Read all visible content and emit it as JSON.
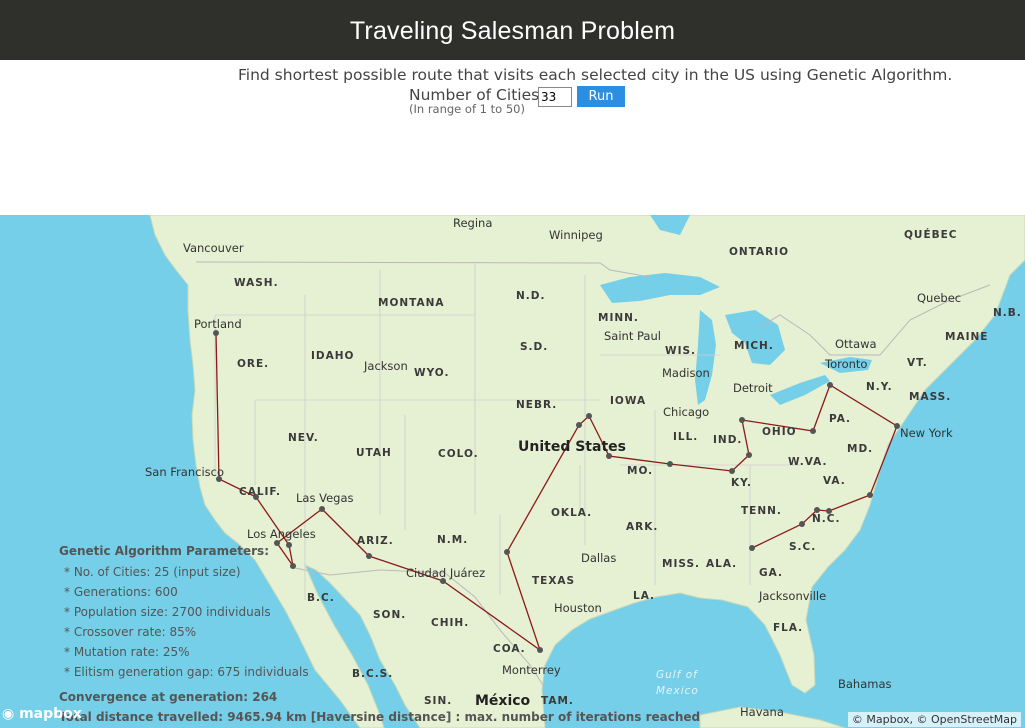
{
  "header": {
    "title": "Traveling Salesman Problem"
  },
  "subtitle": "Find shortest possible route that visits each selected city in the US using Genetic Algorithm.",
  "controls": {
    "cities_label": "Number of Cities",
    "cities_value": "33",
    "run_label": "Run",
    "range_hint": "(In range of 1 to 50)"
  },
  "map": {
    "colors": {
      "water": "#75cfe8",
      "land": "#e6f0d2",
      "route": "#8b1a1a",
      "node": "#555555"
    },
    "labels": {
      "regina": "Regina",
      "winnipeg": "Winnipeg",
      "vancouver": "Vancouver",
      "ontario": "ONTARIO",
      "quebec_prov": "QUÉBEC",
      "quebec_city": "Quebec",
      "wash": "WASH.",
      "montana": "MONTANA",
      "nd": "N.D.",
      "minn": "MINN.",
      "saint_paul": "Saint Paul",
      "wis": "WIS.",
      "mich": "MICH.",
      "ottawa": "Ottawa",
      "nb": "N.B.",
      "maine": "MAINE",
      "portland": "Portland",
      "idaho": "IDAHO",
      "sd": "S.D.",
      "toronto": "Toronto",
      "vt": "VT.",
      "ore": "ORE.",
      "jackson": "Jackson",
      "wyo": "WYO.",
      "madison": "Madison",
      "detroit": "Detroit",
      "ny": "N.Y.",
      "mass": "MASS.",
      "iowa": "IOWA",
      "nebr": "NEBR.",
      "chicago": "Chicago",
      "pa": "PA.",
      "nev": "NEV.",
      "ill": "ILL.",
      "ind": "IND.",
      "ohio": "OHIO",
      "new_york": "New York",
      "utah": "UTAH",
      "colo": "COLO.",
      "united_states": "United States",
      "md": "MD.",
      "san_francisco": "San Francisco",
      "mo": "MO.",
      "wva": "W.VA.",
      "ky": "KY.",
      "va": "VA.",
      "calif": "CALIF.",
      "las_vegas": "Las Vegas",
      "okla": "OKLA.",
      "ark": "ARK.",
      "tenn": "TENN.",
      "nc": "N.C.",
      "los_angeles": "Los Angeles",
      "ariz": "ARIZ.",
      "nm": "N.M.",
      "sc": "S.C.",
      "dallas": "Dallas",
      "miss": "MISS.",
      "ala": "ALA.",
      "ga": "GA.",
      "ciudad_juarez": "Ciudad Juárez",
      "texas": "TEXAS",
      "bc": "B.C.",
      "son": "SON.",
      "houston": "Houston",
      "jacksonville": "Jacksonville",
      "la": "LA.",
      "chih": "CHIH.",
      "fla": "FLA.",
      "coa": "COA.",
      "monterrey": "Monterrey",
      "gulf1": "Gulf of",
      "gulf2": "Mexico",
      "bcs": "B.C.S.",
      "bahamas": "Bahamas",
      "sin": "SIN.",
      "mexico": "México",
      "tam": "TAM.",
      "havana": "Havana"
    },
    "attribution": "© Mapbox, © OpenStreetMap",
    "logo": "mapbox"
  },
  "params": {
    "title": "Genetic Algorithm Parameters:",
    "items": [
      "*  No. of Cities: 25 (input size)",
      "*  Generations: 600",
      "*  Population size: 2700 individuals",
      "*  Crossover rate: 85%",
      "*  Mutation rate: 25%",
      "*  Elitism generation gap: 675 individuals"
    ],
    "convergence": "Convergence at generation: 264",
    "total": "Total distance travelled: 9465.94 km [Haversine distance] : max. number of iterations reached"
  }
}
